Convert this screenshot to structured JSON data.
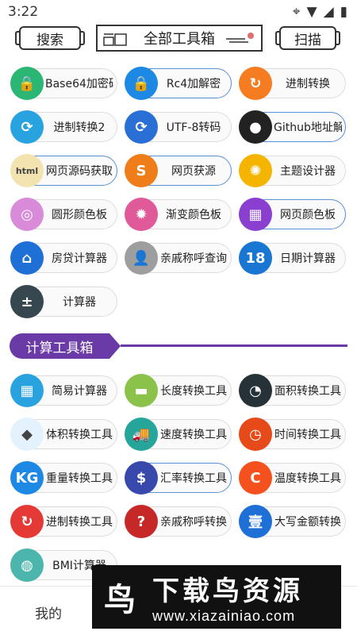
{
  "status": {
    "time": "3:22"
  },
  "header": {
    "search_label": "搜索",
    "title": "全部工具箱",
    "scan_label": "扫描"
  },
  "tools_top": [
    {
      "label": "Base64加密码",
      "icon": "lock-icon",
      "color": "#2bb673",
      "glyph": "🔒"
    },
    {
      "label": "Rc4加解密",
      "icon": "lock-icon",
      "color": "#1e88e5",
      "glyph": "🔒"
    },
    {
      "label": "进制转换",
      "icon": "refresh-icon",
      "color": "#f57c20",
      "glyph": "↻"
    },
    {
      "label": "进制转换2",
      "icon": "sync-icon",
      "color": "#29a3e0",
      "glyph": "⟳"
    },
    {
      "label": "UTF-8转码",
      "icon": "sync-icon",
      "color": "#2a6fd6",
      "glyph": "⟳"
    },
    {
      "label": "Github地址解...",
      "icon": "github-icon",
      "color": "#222222",
      "glyph": "●"
    },
    {
      "label": "网页源码获取",
      "icon": "html-icon",
      "color": "#f3e3b0",
      "glyph": "html"
    },
    {
      "label": "网页获源",
      "icon": "sublime-icon",
      "color": "#ef7d1a",
      "glyph": "S"
    },
    {
      "label": "主题设计器",
      "icon": "color-wheel-icon",
      "color": "#f4b400",
      "glyph": "✺"
    },
    {
      "label": "圆形颜色板",
      "icon": "palette-icon",
      "color": "#d98ad9",
      "glyph": "◎"
    },
    {
      "label": "渐变颜色板",
      "icon": "palette-icon",
      "color": "#e05a9a",
      "glyph": "✹"
    },
    {
      "label": "网页颜色板",
      "icon": "palette-icon",
      "color": "#8a3fd1",
      "glyph": "▦"
    },
    {
      "label": "房贷计算器",
      "icon": "house-icon",
      "color": "#1e6fd6",
      "glyph": "⌂"
    },
    {
      "label": "亲戚称呼查询",
      "icon": "person-icon",
      "color": "#9e9e9e",
      "glyph": "👤"
    },
    {
      "label": "日期计算器",
      "icon": "calendar-icon",
      "color": "#1976d2",
      "glyph": "18"
    },
    {
      "label": "计算器",
      "icon": "calculator-icon",
      "color": "#37474f",
      "glyph": "±"
    }
  ],
  "section": {
    "title": "计算工具箱"
  },
  "tools_calc": [
    {
      "label": "简易计算器",
      "icon": "calculator-icon",
      "color": "#29a3e0",
      "glyph": "▦"
    },
    {
      "label": "长度转换工具",
      "icon": "ruler-icon",
      "color": "#8bc34a",
      "glyph": "▬"
    },
    {
      "label": "面积转换工具",
      "icon": "radar-icon",
      "color": "#263238",
      "glyph": "◔"
    },
    {
      "label": "体积转换工具",
      "icon": "dropbox-icon",
      "color": "#e3f2fd",
      "glyph": "◆"
    },
    {
      "label": "速度转换工具",
      "icon": "truck-icon",
      "color": "#26a69a",
      "glyph": "🚚"
    },
    {
      "label": "时间转换工具",
      "icon": "clock-icon",
      "color": "#e64a19",
      "glyph": "◷"
    },
    {
      "label": "重量转换工具",
      "icon": "weight-icon",
      "color": "#1e88e5",
      "glyph": "KG"
    },
    {
      "label": "汇率转换工具",
      "icon": "currency-icon",
      "color": "#3949ab",
      "glyph": "$"
    },
    {
      "label": "温度转换工具",
      "icon": "temperature-icon",
      "color": "#f4511e",
      "glyph": "C"
    },
    {
      "label": "进制转换工具",
      "icon": "refresh-icon",
      "color": "#e53935",
      "glyph": "↻"
    },
    {
      "label": "亲戚称呼转换",
      "icon": "person-icon",
      "color": "#c62828",
      "glyph": "?"
    },
    {
      "label": "大写金额转换",
      "icon": "money-icon",
      "color": "#1e6fd6",
      "glyph": "壹"
    },
    {
      "label": "BMI计算器",
      "icon": "bmi-icon",
      "color": "#4db6ac",
      "glyph": "◍"
    }
  ],
  "bottom": {
    "me_label": "我的"
  },
  "watermark": {
    "title": "下载鸟资源",
    "url": "www.xiazainiao.com"
  }
}
